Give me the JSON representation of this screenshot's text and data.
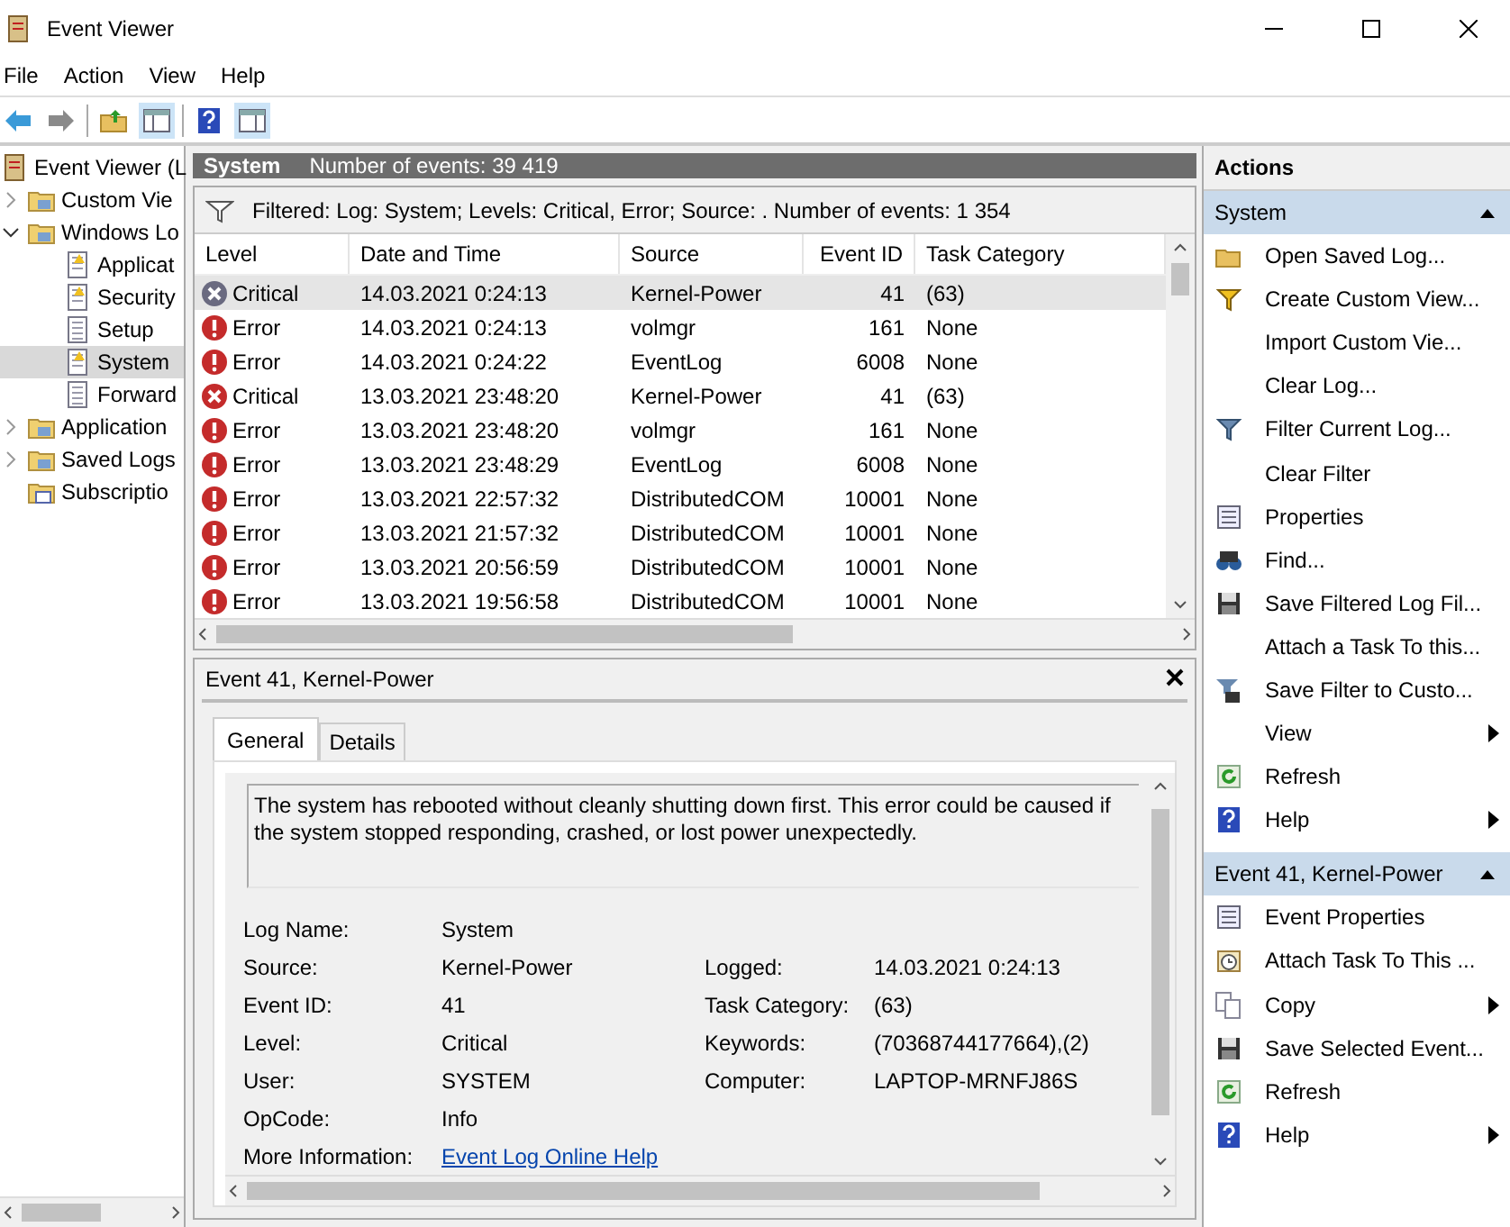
{
  "window": {
    "title": "Event Viewer"
  },
  "menu": [
    "File",
    "Action",
    "View",
    "Help"
  ],
  "tree": [
    {
      "label": "Event Viewer (L",
      "kind": "viewer",
      "selected": false,
      "children": [
        {
          "label": "Custom Vie",
          "kind": "folder",
          "selected": false,
          "expanded": false
        },
        {
          "label": "Windows Lo",
          "kind": "folder",
          "selected": false,
          "expanded": true,
          "children": [
            {
              "label": "Applicat",
              "kind": "log",
              "selected": false
            },
            {
              "label": "Security",
              "kind": "log",
              "selected": false
            },
            {
              "label": "Setup",
              "kind": "page",
              "selected": false
            },
            {
              "label": "System",
              "kind": "log",
              "selected": true
            },
            {
              "label": "Forward",
              "kind": "page",
              "selected": false
            }
          ]
        },
        {
          "label": "Application",
          "kind": "folder",
          "selected": false,
          "expanded": false
        },
        {
          "label": "Saved Logs",
          "kind": "folder",
          "selected": false,
          "expanded": false
        },
        {
          "label": "Subscriptio",
          "kind": "subscription",
          "selected": false
        }
      ]
    }
  ],
  "log_header": {
    "title": "System",
    "count": "Number of events: 39 419"
  },
  "filter": "Filtered: Log: System; Levels: Critical, Error; Source: . Number of events: 1 354",
  "table": {
    "columns": [
      "Level",
      "Date and Time",
      "Source",
      "Event ID",
      "Task Category"
    ],
    "rows": [
      {
        "kind": "critical",
        "selected": true,
        "cells": [
          "Critical",
          "14.03.2021 0:24:13",
          "Kernel-Power",
          "41",
          "(63)"
        ]
      },
      {
        "kind": "error",
        "selected": false,
        "cells": [
          "Error",
          "14.03.2021 0:24:13",
          "volmgr",
          "161",
          "None"
        ]
      },
      {
        "kind": "error",
        "selected": false,
        "cells": [
          "Error",
          "14.03.2021 0:24:22",
          "EventLog",
          "6008",
          "None"
        ]
      },
      {
        "kind": "critical",
        "selected": false,
        "cells": [
          "Critical",
          "13.03.2021 23:48:20",
          "Kernel-Power",
          "41",
          "(63)"
        ]
      },
      {
        "kind": "error",
        "selected": false,
        "cells": [
          "Error",
          "13.03.2021 23:48:20",
          "volmgr",
          "161",
          "None"
        ]
      },
      {
        "kind": "error",
        "selected": false,
        "cells": [
          "Error",
          "13.03.2021 23:48:29",
          "EventLog",
          "6008",
          "None"
        ]
      },
      {
        "kind": "error",
        "selected": false,
        "cells": [
          "Error",
          "13.03.2021 22:57:32",
          "DistributedCOM",
          "10001",
          "None"
        ]
      },
      {
        "kind": "error",
        "selected": false,
        "cells": [
          "Error",
          "13.03.2021 21:57:32",
          "DistributedCOM",
          "10001",
          "None"
        ]
      },
      {
        "kind": "error",
        "selected": false,
        "cells": [
          "Error",
          "13.03.2021 20:56:59",
          "DistributedCOM",
          "10001",
          "None"
        ]
      },
      {
        "kind": "error",
        "selected": false,
        "cells": [
          "Error",
          "13.03.2021 19:56:58",
          "DistributedCOM",
          "10001",
          "None"
        ]
      }
    ]
  },
  "event_panel": {
    "title": "Event 41, Kernel-Power",
    "tabs": [
      {
        "label": "General",
        "selected": true
      },
      {
        "label": "Details",
        "selected": false
      }
    ],
    "description": "The system has rebooted without cleanly shutting down first. This error could be caused if the system stopped responding, crashed, or lost power unexpectedly.",
    "rows": [
      {
        "left": {
          "label": "Log Name:",
          "value": "System"
        }
      },
      {
        "left": {
          "label": "Source:",
          "value": "Kernel-Power"
        },
        "right": {
          "label": "Logged:",
          "value": "14.03.2021 0:24:13"
        }
      },
      {
        "left": {
          "label": "Event ID:",
          "value": "41"
        },
        "right": {
          "label": "Task Category:",
          "value": "(63)"
        }
      },
      {
        "left": {
          "label": "Level:",
          "value": "Critical"
        },
        "right": {
          "label": "Keywords:",
          "value": "(70368744177664),(2)"
        }
      },
      {
        "left": {
          "label": "User:",
          "value": "SYSTEM"
        },
        "right": {
          "label": "Computer:",
          "value": "LAPTOP-MRNFJ86S"
        }
      },
      {
        "left": {
          "label": "OpCode:",
          "value": "Info"
        }
      }
    ],
    "more_info": {
      "label": "More Information:",
      "link": "Event Log Online Help"
    }
  },
  "actions": {
    "title": "Actions",
    "sections": [
      {
        "title": "System",
        "expanded": true,
        "items": [
          {
            "kind": "open",
            "label": "Open Saved Log...",
            "submenu": false
          },
          {
            "kind": "create-filter",
            "label": "Create Custom View...",
            "submenu": false
          },
          {
            "kind": "none",
            "label": "Import Custom Vie...",
            "submenu": false
          },
          {
            "kind": "none",
            "label": "Clear Log...",
            "submenu": false
          },
          {
            "kind": "filter",
            "label": "Filter Current Log...",
            "submenu": false
          },
          {
            "kind": "none",
            "label": "Clear Filter",
            "submenu": false
          },
          {
            "kind": "properties",
            "label": "Properties",
            "submenu": false
          },
          {
            "kind": "find",
            "label": "Find...",
            "submenu": false
          },
          {
            "kind": "save",
            "label": "Save Filtered Log Fil...",
            "submenu": false
          },
          {
            "kind": "none",
            "label": "Attach a Task To this...",
            "submenu": false
          },
          {
            "kind": "save-filter",
            "label": "Save Filter to Custo...",
            "submenu": false
          },
          {
            "kind": "none",
            "label": "View",
            "submenu": true
          },
          {
            "kind": "refresh",
            "label": "Refresh",
            "submenu": false
          },
          {
            "kind": "help",
            "label": "Help",
            "submenu": true
          }
        ]
      },
      {
        "title": "Event 41, Kernel-Power",
        "expanded": true,
        "items": [
          {
            "kind": "properties",
            "label": "Event Properties",
            "submenu": false
          },
          {
            "kind": "task",
            "label": "Attach Task To This ...",
            "submenu": false
          },
          {
            "kind": "copy",
            "label": "Copy",
            "submenu": true
          },
          {
            "kind": "save",
            "label": "Save Selected Event...",
            "submenu": false
          },
          {
            "kind": "refresh",
            "label": "Refresh",
            "submenu": false
          },
          {
            "kind": "help",
            "label": "Help",
            "submenu": true
          }
        ]
      }
    ]
  }
}
